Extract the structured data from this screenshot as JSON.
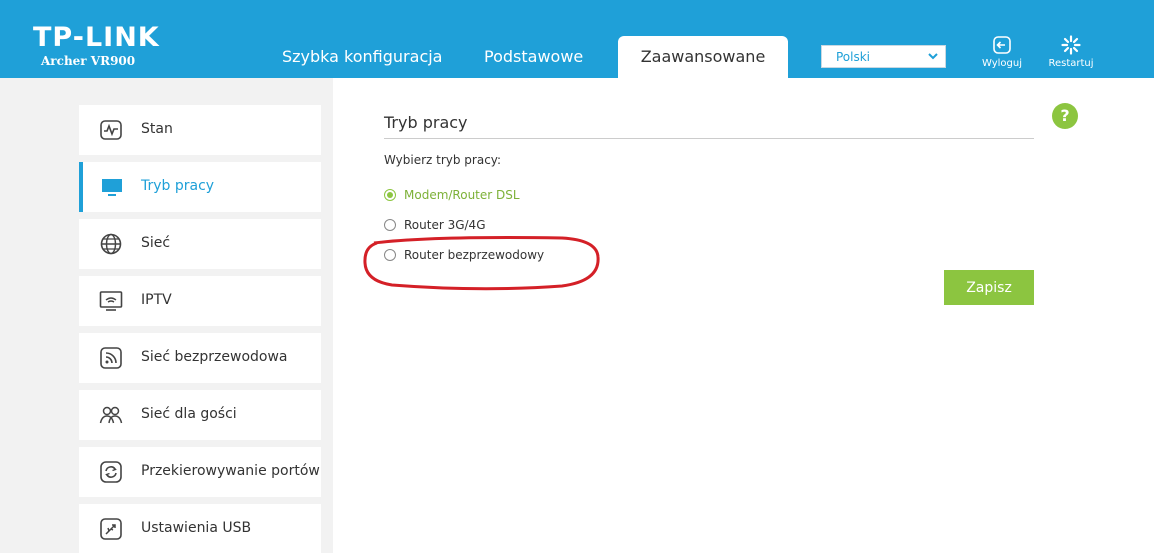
{
  "header": {
    "logo": "TP-LINK",
    "model": "Archer VR900",
    "tabs": [
      {
        "label": "Szybka konfiguracja",
        "active": false
      },
      {
        "label": "Podstawowe",
        "active": false
      },
      {
        "label": "Zaawansowane",
        "active": true
      }
    ],
    "language": {
      "selected": "Polski"
    },
    "logout_label": "Wyloguj",
    "restart_label": "Restartuj"
  },
  "sidebar": {
    "items": [
      {
        "label": "Stan",
        "icon": "status-chart-icon",
        "active": false
      },
      {
        "label": "Tryb pracy",
        "icon": "monitor-icon",
        "active": true
      },
      {
        "label": "Sieć",
        "icon": "globe-icon",
        "active": false
      },
      {
        "label": "IPTV",
        "icon": "tv-icon",
        "active": false
      },
      {
        "label": "Sieć bezprzewodowa",
        "icon": "wireless-icon",
        "active": false
      },
      {
        "label": "Sieć dla gości",
        "icon": "guests-icon",
        "active": false
      },
      {
        "label": "Przekierowywanie portów",
        "icon": "port-forward-icon",
        "active": false
      },
      {
        "label": "Ustawienia USB",
        "icon": "usb-icon",
        "active": false
      }
    ]
  },
  "main": {
    "title": "Tryb pracy",
    "prompt": "Wybierz tryb pracy:",
    "options": [
      {
        "label": "Modem/Router DSL",
        "checked": true
      },
      {
        "label": "Router 3G/4G",
        "checked": false
      },
      {
        "label": "Router bezprzewodowy",
        "checked": false
      }
    ],
    "save_label": "Zapisz",
    "help_symbol": "?"
  },
  "colors": {
    "header_blue": "#1fa0d8",
    "accent_green": "#8cc540",
    "annotation_red": "#d42027"
  }
}
